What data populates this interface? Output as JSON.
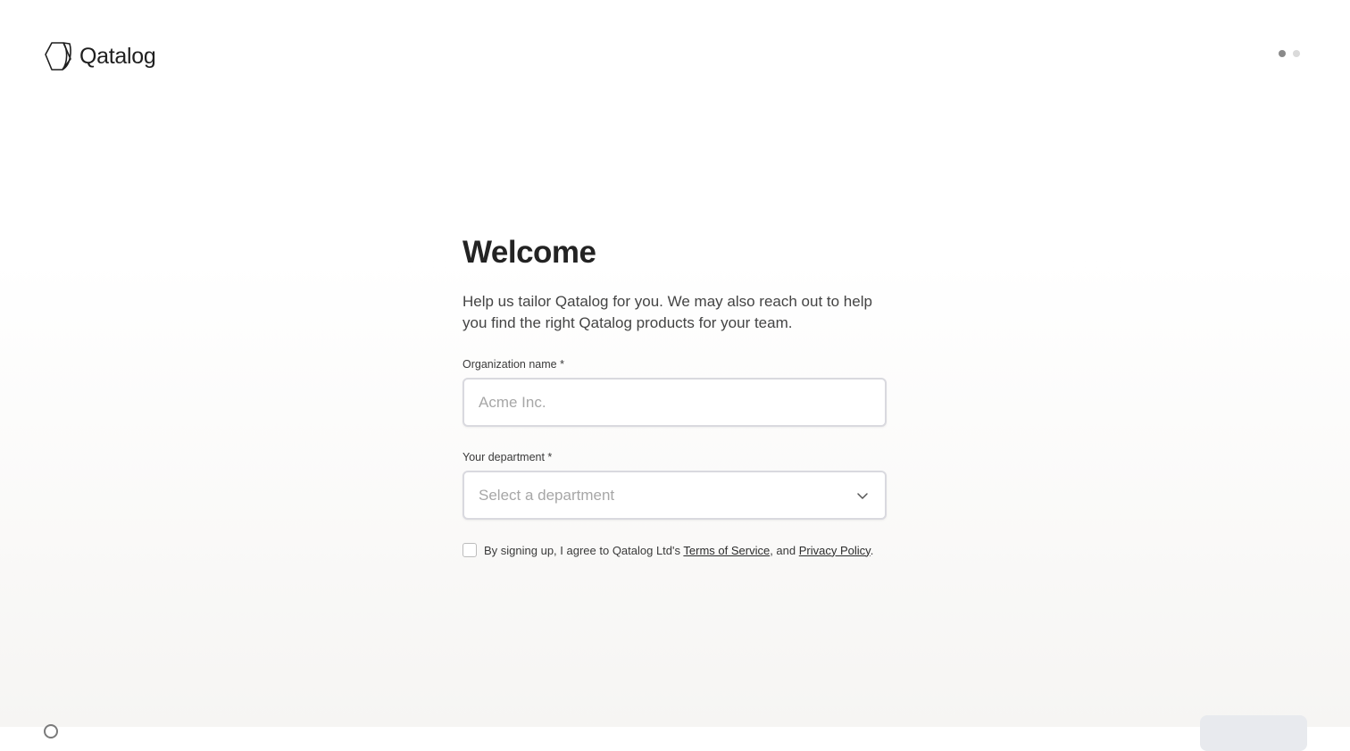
{
  "brand": {
    "name": "Qatalog",
    "logo_icon": "qatalog-logo-icon"
  },
  "steps": {
    "total": 2,
    "current": 1
  },
  "main": {
    "title": "Welcome",
    "subtitle": "Help us tailor Qatalog for you. We may also reach out to help you find the right Qatalog products for your team."
  },
  "form": {
    "organization": {
      "label": "Organization name *",
      "placeholder": "Acme Inc.",
      "value": ""
    },
    "department": {
      "label": "Your department *",
      "placeholder": "Select a department",
      "icon": "chevron-down-icon"
    },
    "consent": {
      "checked": false,
      "prefix": "By signing up, I agree to Qatalog Ltd's ",
      "terms_link": "Terms of Service",
      "middle": ", and ",
      "privacy_link": "Privacy Policy",
      "suffix": "."
    }
  },
  "colors": {
    "text_primary": "#232323",
    "input_border": "#d9d9df",
    "placeholder": "#a7a7a7",
    "step_active": "#8a8a8a",
    "step_inactive": "#dadada"
  }
}
